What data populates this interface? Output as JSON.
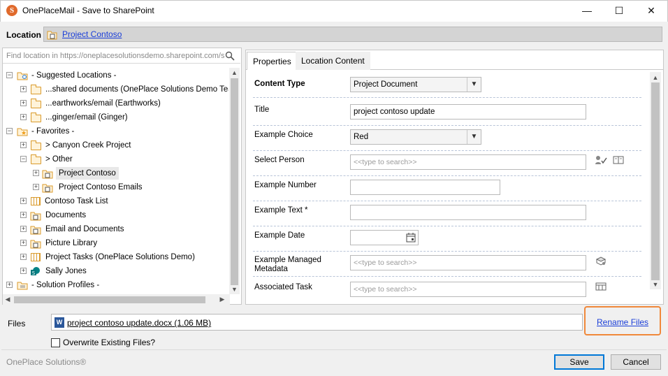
{
  "window": {
    "title": "OnePlaceMail - Save to SharePoint",
    "app_icon_letter": "S",
    "minimize": "—",
    "maximize": "☐",
    "close": "✕"
  },
  "location": {
    "label": "Location",
    "value": "Project Contoso"
  },
  "search": {
    "placeholder": "Find location in https://oneplacesolutionsdemo.sharepoint.com/sites"
  },
  "tree": {
    "items": [
      {
        "label": "- Suggested Locations -"
      },
      {
        "label": "...shared documents (OnePlace Solutions Demo Team S"
      },
      {
        "label": "...earthworks/email (Earthworks)"
      },
      {
        "label": "...ginger/email (Ginger)"
      },
      {
        "label": "- Favorites -"
      },
      {
        "label": "> Canyon Creek Project"
      },
      {
        "label": "> Other"
      },
      {
        "label": "Project Contoso"
      },
      {
        "label": "Project Contoso Emails"
      },
      {
        "label": "Contoso Task List"
      },
      {
        "label": "Documents"
      },
      {
        "label": "Email and Documents"
      },
      {
        "label": "Picture Library"
      },
      {
        "label": "Project Tasks (OnePlace Solutions Demo)"
      },
      {
        "label": "Sally Jones"
      },
      {
        "label": "- Solution Profiles -"
      }
    ]
  },
  "tabs": [
    {
      "label": "Properties"
    },
    {
      "label": "Location Content"
    }
  ],
  "properties": {
    "content_type": {
      "label": "Content Type",
      "value": "Project Document"
    },
    "title": {
      "label": "Title",
      "value": "project contoso update"
    },
    "example_choice": {
      "label": "Example Choice",
      "value": "Red"
    },
    "select_person": {
      "label": "Select Person",
      "placeholder": "<<type to search>>"
    },
    "example_number": {
      "label": "Example Number",
      "value": ""
    },
    "example_text": {
      "label": "Example Text *",
      "value": ""
    },
    "example_date": {
      "label": "Example Date",
      "value": ""
    },
    "example_managed_metadata": {
      "label": "Example Managed Metadata",
      "placeholder": "<<type to search>>"
    },
    "associated_task": {
      "label": "Associated Task",
      "placeholder": "<<type to search>>"
    }
  },
  "files": {
    "label": "Files",
    "file_name": "project contoso update.docx (1.06 MB)",
    "rename_label": "Rename Files",
    "overwrite_label": "Overwrite Existing Files?",
    "overwrite_checked": false
  },
  "footer": {
    "brand": "OnePlace Solutions®",
    "save_label": "Save",
    "cancel_label": "Cancel"
  },
  "colors": {
    "link": "#1a3ed8",
    "highlight": "#f0883a",
    "brand_icon": "#e06a2c",
    "word": "#2b579a"
  }
}
